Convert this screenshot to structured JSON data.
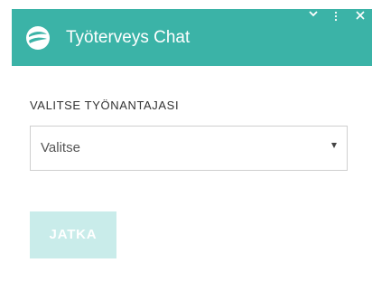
{
  "header": {
    "title": "Työterveys Chat",
    "logo_icon": "chat-logo-icon",
    "minimize_icon": "chevron-down-icon",
    "menu_icon": "vertical-dots-icon",
    "close_icon": "close-icon",
    "background": "#3bb3a7"
  },
  "form": {
    "employer_label": "VALITSE TYÖNANTAJASI",
    "employer_select_value": "Valitse"
  },
  "actions": {
    "continue_label": "JATKA",
    "continue_disabled": true,
    "continue_color": "#c9ecea"
  }
}
